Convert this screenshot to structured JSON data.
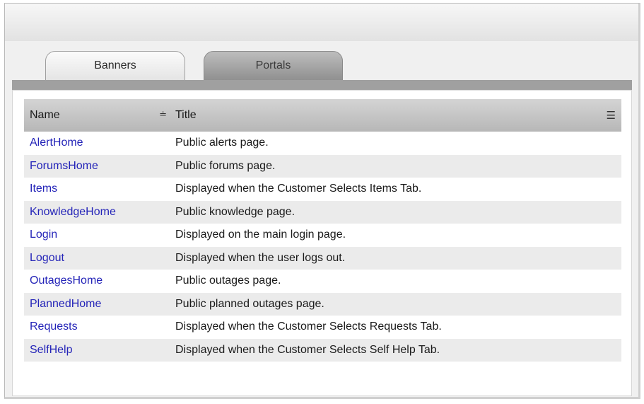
{
  "tabs": [
    {
      "label": "Banners",
      "active": true
    },
    {
      "label": "Portals",
      "active": false
    }
  ],
  "table": {
    "columns": {
      "name": "Name",
      "title": "Title"
    },
    "sort_icon": "sort-ascending-icon",
    "menu_icon": "column-menu-icon",
    "rows": [
      {
        "name": "AlertHome",
        "title": "Public alerts page."
      },
      {
        "name": "ForumsHome",
        "title": "Public forums page."
      },
      {
        "name": "Items",
        "title": "Displayed when the Customer Selects Items Tab."
      },
      {
        "name": "KnowledgeHome",
        "title": "Public knowledge page."
      },
      {
        "name": "Login",
        "title": "Displayed on the main login page."
      },
      {
        "name": "Logout",
        "title": "Displayed when the user logs out."
      },
      {
        "name": "OutagesHome",
        "title": "Public outages page."
      },
      {
        "name": "PlannedHome",
        "title": "Public planned outages page."
      },
      {
        "name": "Requests",
        "title": "Displayed when the Customer Selects Requests Tab."
      },
      {
        "name": "SelfHelp",
        "title": "Displayed when the Customer Selects Self Help Tab."
      }
    ]
  },
  "colors": {
    "link": "#2424b8",
    "header_bg": "#c4c4c4",
    "tabstrip": "#a0a0a0"
  }
}
